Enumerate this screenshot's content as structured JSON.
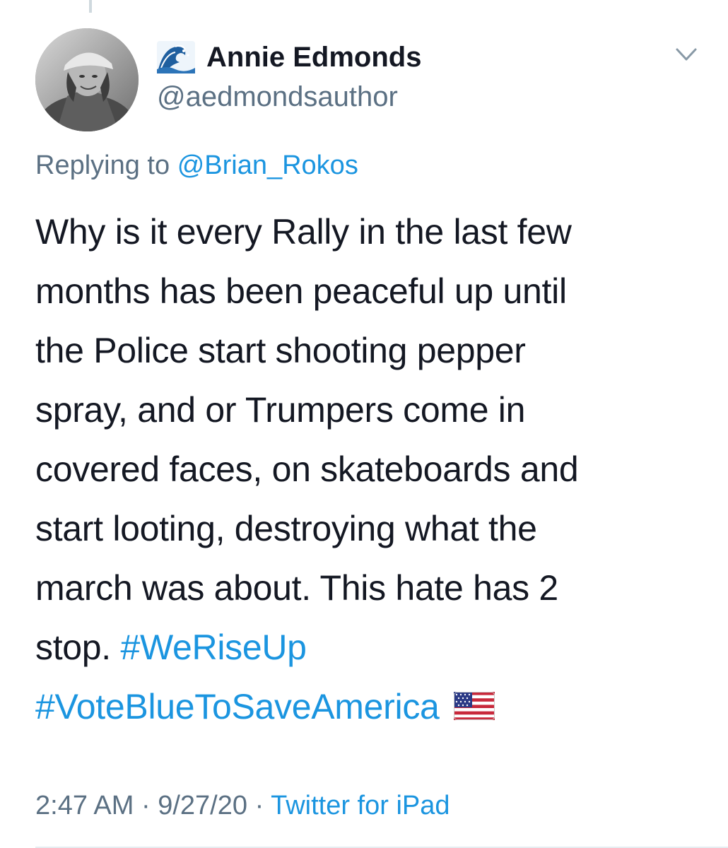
{
  "tweet": {
    "author": {
      "display_name": "Annie Edmonds",
      "handle": "@aedmondsauthor",
      "name_icon": "wave-emoji-icon",
      "avatar": "avatar-photo"
    },
    "replying_to_prefix": "Replying to",
    "replying_to_handle": "@Brian_Rokos",
    "text_lines": [
      "Why is it every Rally in the last few",
      "months has been peaceful up until",
      "the Police start shooting pepper",
      "spray, and or Trumpers come in",
      "covered faces, on skateboards and",
      "start looting, destroying what the",
      "march was about. This hate has 2"
    ],
    "last_line_text": "stop.",
    "hashtags": [
      "#WeRiseUp",
      "#VoteBlueToSaveAmerica"
    ],
    "trailing_icon": "us-flag-emoji-icon",
    "time": "2:47 AM",
    "separator": "·",
    "date": "9/27/20",
    "source": "Twitter for iPad",
    "menu_icon": "chevron-down-icon"
  },
  "colors": {
    "text": "#141823",
    "secondary": "#5b7083",
    "link": "#1b95e0"
  }
}
